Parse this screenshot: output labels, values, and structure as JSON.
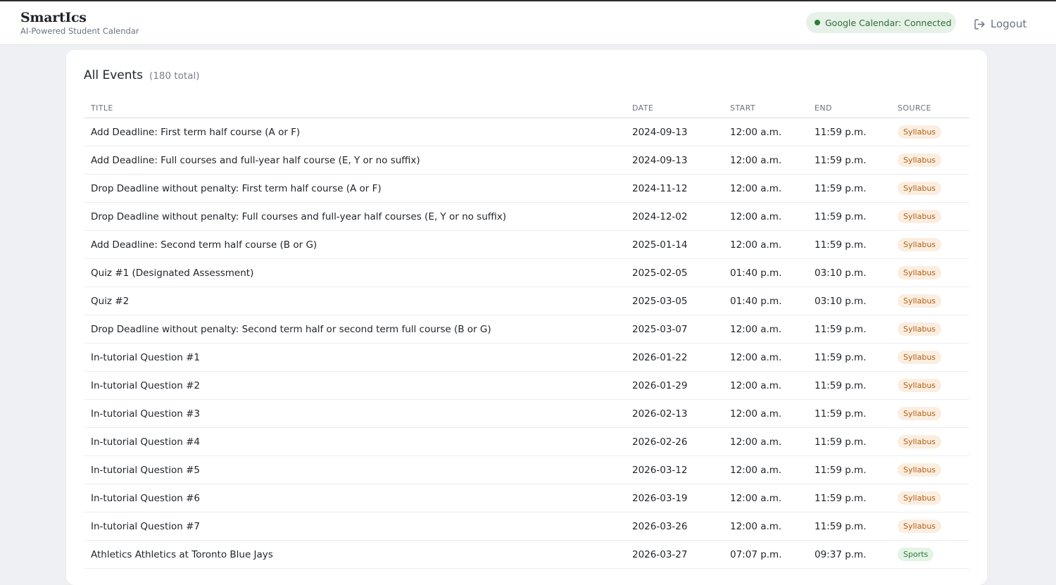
{
  "header": {
    "brand": "SmartIcs",
    "tagline": "AI-Powered Student Calendar",
    "calendar_status": "Google Calendar: Connected",
    "logout_label": "Logout",
    "icons": {
      "logout": "logout-icon",
      "status": "status-dot-icon"
    }
  },
  "colors": {
    "syllabus_badge_bg": "#fbeee0",
    "syllabus_badge_text": "#b35f17",
    "sports_badge_bg": "#e3f3e4",
    "sports_badge_text": "#2f7d3a",
    "connected_badge_bg": "#e6f2e7"
  },
  "events": {
    "title": "All Events",
    "count": "(180 total)",
    "columns": [
      "TITLE",
      "DATE",
      "START",
      "END",
      "SOURCE"
    ],
    "rows": [
      {
        "title": "Add Deadline: First term half course (A or F)",
        "date": "2024-09-13",
        "start": "12:00 a.m.",
        "end": "11:59 p.m.",
        "source": "Syllabus"
      },
      {
        "title": "Add Deadline: Full courses and full-year half course (E, Y or no suffix)",
        "date": "2024-09-13",
        "start": "12:00 a.m.",
        "end": "11:59 p.m.",
        "source": "Syllabus"
      },
      {
        "title": "Drop Deadline without penalty: First term half course (A or F)",
        "date": "2024-11-12",
        "start": "12:00 a.m.",
        "end": "11:59 p.m.",
        "source": "Syllabus"
      },
      {
        "title": "Drop Deadline without penalty: Full courses and full-year half courses (E, Y or no suffix)",
        "date": "2024-12-02",
        "start": "12:00 a.m.",
        "end": "11:59 p.m.",
        "source": "Syllabus"
      },
      {
        "title": "Add Deadline: Second term half course (B or G)",
        "date": "2025-01-14",
        "start": "12:00 a.m.",
        "end": "11:59 p.m.",
        "source": "Syllabus"
      },
      {
        "title": "Quiz #1 (Designated Assessment)",
        "date": "2025-02-05",
        "start": "01:40 p.m.",
        "end": "03:10 p.m.",
        "source": "Syllabus"
      },
      {
        "title": "Quiz #2",
        "date": "2025-03-05",
        "start": "01:40 p.m.",
        "end": "03:10 p.m.",
        "source": "Syllabus"
      },
      {
        "title": "Drop Deadline without penalty: Second term half or second term full course (B or G)",
        "date": "2025-03-07",
        "start": "12:00 a.m.",
        "end": "11:59 p.m.",
        "source": "Syllabus"
      },
      {
        "title": "In-tutorial Question #1",
        "date": "2026-01-22",
        "start": "12:00 a.m.",
        "end": "11:59 p.m.",
        "source": "Syllabus"
      },
      {
        "title": "In-tutorial Question #2",
        "date": "2026-01-29",
        "start": "12:00 a.m.",
        "end": "11:59 p.m.",
        "source": "Syllabus"
      },
      {
        "title": "In-tutorial Question #3",
        "date": "2026-02-13",
        "start": "12:00 a.m.",
        "end": "11:59 p.m.",
        "source": "Syllabus"
      },
      {
        "title": "In-tutorial Question #4",
        "date": "2026-02-26",
        "start": "12:00 a.m.",
        "end": "11:59 p.m.",
        "source": "Syllabus"
      },
      {
        "title": "In-tutorial Question #5",
        "date": "2026-03-12",
        "start": "12:00 a.m.",
        "end": "11:59 p.m.",
        "source": "Syllabus"
      },
      {
        "title": "In-tutorial Question #6",
        "date": "2026-03-19",
        "start": "12:00 a.m.",
        "end": "11:59 p.m.",
        "source": "Syllabus"
      },
      {
        "title": "In-tutorial Question #7",
        "date": "2026-03-26",
        "start": "12:00 a.m.",
        "end": "11:59 p.m.",
        "source": "Syllabus"
      },
      {
        "title": "Athletics Athletics at Toronto Blue Jays",
        "date": "2026-03-27",
        "start": "07:07 p.m.",
        "end": "09:37 p.m.",
        "source": "Sports"
      }
    ]
  }
}
